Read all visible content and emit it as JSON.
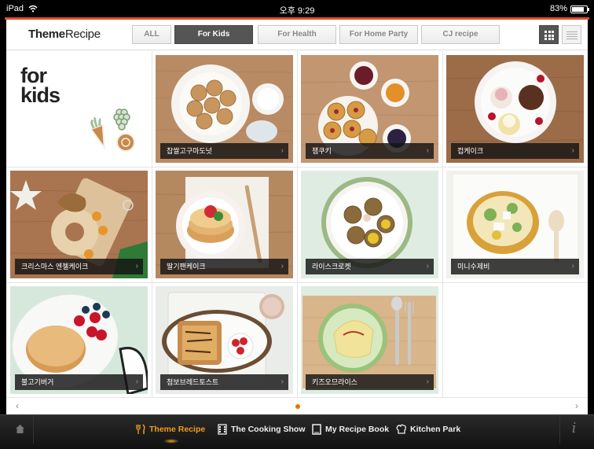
{
  "status_bar": {
    "device": "iPad",
    "time": "오후 9:29",
    "battery": "83%",
    "battery_level": 0.83
  },
  "header": {
    "logo_bold": "Theme",
    "logo_rest": "Recipe",
    "tabs": [
      {
        "label": "ALL",
        "active": false
      },
      {
        "label": "For Kids",
        "active": true
      },
      {
        "label": "For Health",
        "active": false
      },
      {
        "label": "For Home Party",
        "active": false
      },
      {
        "label": "CJ recipe",
        "active": false
      }
    ],
    "view_modes": [
      "grid-view",
      "list-view"
    ],
    "active_view": "grid-view"
  },
  "intro": {
    "line1": "for",
    "line2": "kids"
  },
  "recipes": [
    {
      "title": "찹쌀고구마도넛"
    },
    {
      "title": "잼쿠키"
    },
    {
      "title": "컵케이크"
    },
    {
      "title": "크리스마스 엔젤케이크"
    },
    {
      "title": "딸기팬케이크"
    },
    {
      "title": "라이스크로켓"
    },
    {
      "title": "미니수제비"
    },
    {
      "title": "불고기버거"
    },
    {
      "title": "첨보브레드토스트"
    },
    {
      "title": "키즈오므라이스"
    }
  ],
  "pager": {
    "current": 1,
    "total": 1
  },
  "bottom_nav": [
    {
      "label": "Theme Recipe",
      "icon": "fork-knife-icon",
      "active": true
    },
    {
      "label": "The Cooking Show",
      "icon": "film-icon",
      "active": false
    },
    {
      "label": "My Recipe Book",
      "icon": "book-icon",
      "active": false
    },
    {
      "label": "Kitchen Park",
      "icon": "chef-hat-icon",
      "active": false
    }
  ],
  "colors": {
    "accent": "#e44d2a",
    "nav_active": "#f39a1e",
    "tab_active_bg": "#555555",
    "page_dot": "#e8730d"
  }
}
